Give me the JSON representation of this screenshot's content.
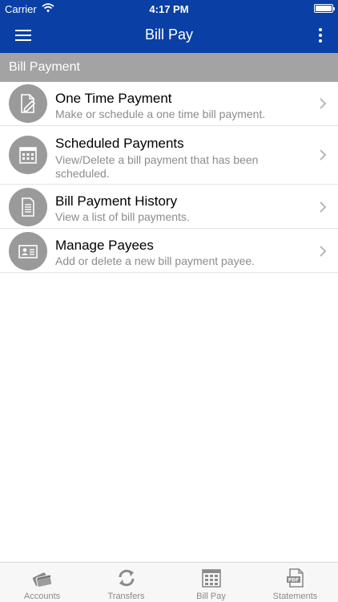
{
  "status_bar": {
    "carrier": "Carrier",
    "time": "4:17 PM"
  },
  "nav": {
    "title": "Bill Pay",
    "menu_icon": "hamburger-icon",
    "more_icon": "more-vertical-icon"
  },
  "section": {
    "title": "Bill Payment"
  },
  "items": [
    {
      "title": "One Time Payment",
      "subtitle": "Make or schedule a one time bill payment.",
      "icon": "document-pencil-icon"
    },
    {
      "title": "Scheduled Payments",
      "subtitle": "View/Delete a bill payment that has been scheduled.",
      "icon": "calendar-icon"
    },
    {
      "title": "Bill Payment History",
      "subtitle": "View a list of bill payments.",
      "icon": "document-list-icon"
    },
    {
      "title": "Manage Payees",
      "subtitle": "Add or delete a new bill payment payee.",
      "icon": "id-card-icon"
    }
  ],
  "tabs": [
    {
      "label": "Accounts",
      "icon": "cards-icon"
    },
    {
      "label": "Transfers",
      "icon": "refresh-icon"
    },
    {
      "label": "Bill Pay",
      "icon": "calendar-icon"
    },
    {
      "label": "Statements",
      "icon": "pdf-icon"
    }
  ],
  "colors": {
    "nav_bg": "#0a3fa6",
    "section_bg": "#a3a3a3",
    "icon_circle": "#9a9a9a"
  }
}
